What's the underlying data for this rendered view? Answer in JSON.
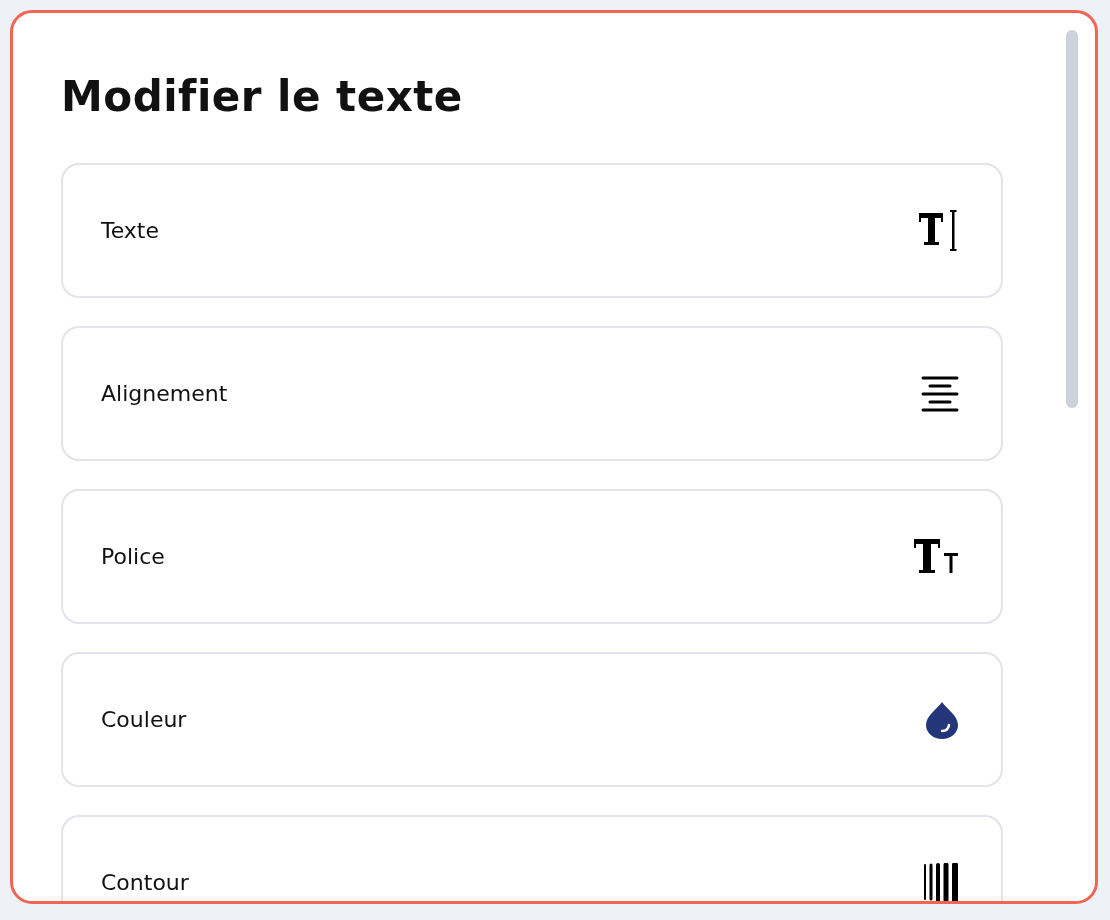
{
  "panel": {
    "title": "Modifier le texte",
    "options": [
      {
        "label": "Texte",
        "kind": "text"
      },
      {
        "label": "Alignement",
        "kind": "align"
      },
      {
        "label": "Police",
        "kind": "font"
      },
      {
        "label": "Couleur",
        "kind": "color"
      },
      {
        "label": "Contour",
        "kind": "stroke"
      }
    ]
  }
}
